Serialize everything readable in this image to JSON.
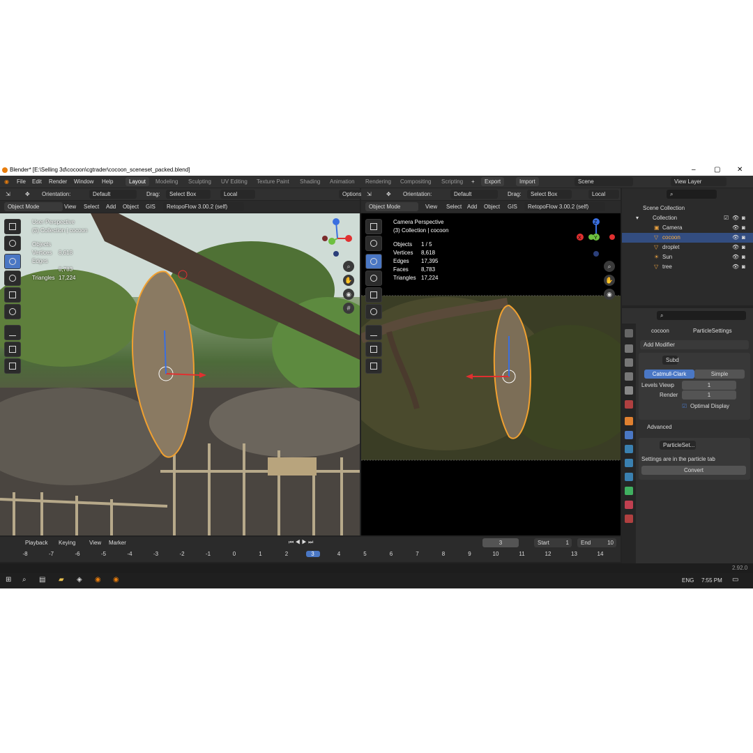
{
  "window": {
    "title": "Blender* [E:\\Selling 3d\\cocoon\\cgtrader\\cocoon_sceneset_packed.blend]"
  },
  "menu": {
    "items": [
      "File",
      "Edit",
      "Render",
      "Window",
      "Help"
    ]
  },
  "workspaces": [
    "Layout",
    "Modeling",
    "Sculpting",
    "UV Editing",
    "Texture Paint",
    "Shading",
    "Animation",
    "Rendering",
    "Compositing",
    "Scripting"
  ],
  "export_label": "Export",
  "import_label": "Import",
  "scene_name": "Scene",
  "view_layer": "View Layer",
  "toolbar": {
    "orientation_label": "Orientation:",
    "orientation_value": "Default",
    "drag_label": "Drag:",
    "drag_value": "Select Box",
    "pivot_value": "Local",
    "options_label": "Options"
  },
  "viewport_header": {
    "mode": "Object Mode",
    "items": [
      "View",
      "Select",
      "Add",
      "Object",
      "GIS"
    ],
    "addon": "RetopoFlow 3.00.2 (self)"
  },
  "left_viewport": {
    "line1": "User Perspective",
    "line2": "(3) Collection | cocoon",
    "objects_label": "Objects",
    "vertices_label": "Vertices",
    "vertices_value": "8,618",
    "edges_label": "Edges",
    "edges_value": "8,783",
    "triangles_label": "Triangles",
    "triangles_value": "17,224"
  },
  "right_viewport": {
    "line1": "Camera Perspective",
    "line2": "(3) Collection | cocoon",
    "objects_label": "Objects",
    "objects_value": "1 / 5",
    "vertices_label": "Vertices",
    "vertices_value": "8,618",
    "edges_label": "Edges",
    "edges_value": "17,395",
    "faces_label": "Faces",
    "faces_value": "8,783",
    "triangles_label": "Triangles",
    "triangles_value": "17,224"
  },
  "gizmo": {
    "z": "Z",
    "x": "X",
    "y": "Y"
  },
  "outliner": {
    "root": "Scene Collection",
    "collection": "Collection",
    "items": [
      "Camera",
      "cocoon",
      "droplet",
      "Sun",
      "tree"
    ]
  },
  "properties": {
    "object_name": "cocoon",
    "particle_settings": "ParticleSettings",
    "add_modifier": "Add Modifier",
    "subd_name": "Subd",
    "catmull": "Catmull-Clark",
    "simple": "Simple",
    "levels_viewport_label": "Levels Viewp",
    "levels_viewport_value": "1",
    "render_label": "Render",
    "render_value": "1",
    "optimal_display": "Optimal Display",
    "advanced": "Advanced",
    "particle_mod_name": "ParticleSet...",
    "particle_info": "Settings are in the particle tab",
    "convert": "Convert"
  },
  "timeline": {
    "playback": "Playback",
    "keying": "Keying",
    "view": "View",
    "marker": "Marker",
    "current_frame": "3",
    "start_label": "Start",
    "start_value": "1",
    "end_label": "End",
    "end_value": "10",
    "ticks": [
      "-8",
      "-7",
      "-6",
      "-5",
      "-4",
      "-3",
      "-2",
      "-1",
      "0",
      "1",
      "2",
      "3",
      "4",
      "5",
      "6",
      "7",
      "8",
      "9",
      "10",
      "11",
      "12",
      "13",
      "14"
    ]
  },
  "status": {
    "version": "2.92.0"
  },
  "taskbar": {
    "lang": "ENG",
    "time": "7:55 PM"
  },
  "colors": {
    "accent": "#4a77c4",
    "selection": "#334d80",
    "orange": "#e87d0d"
  }
}
